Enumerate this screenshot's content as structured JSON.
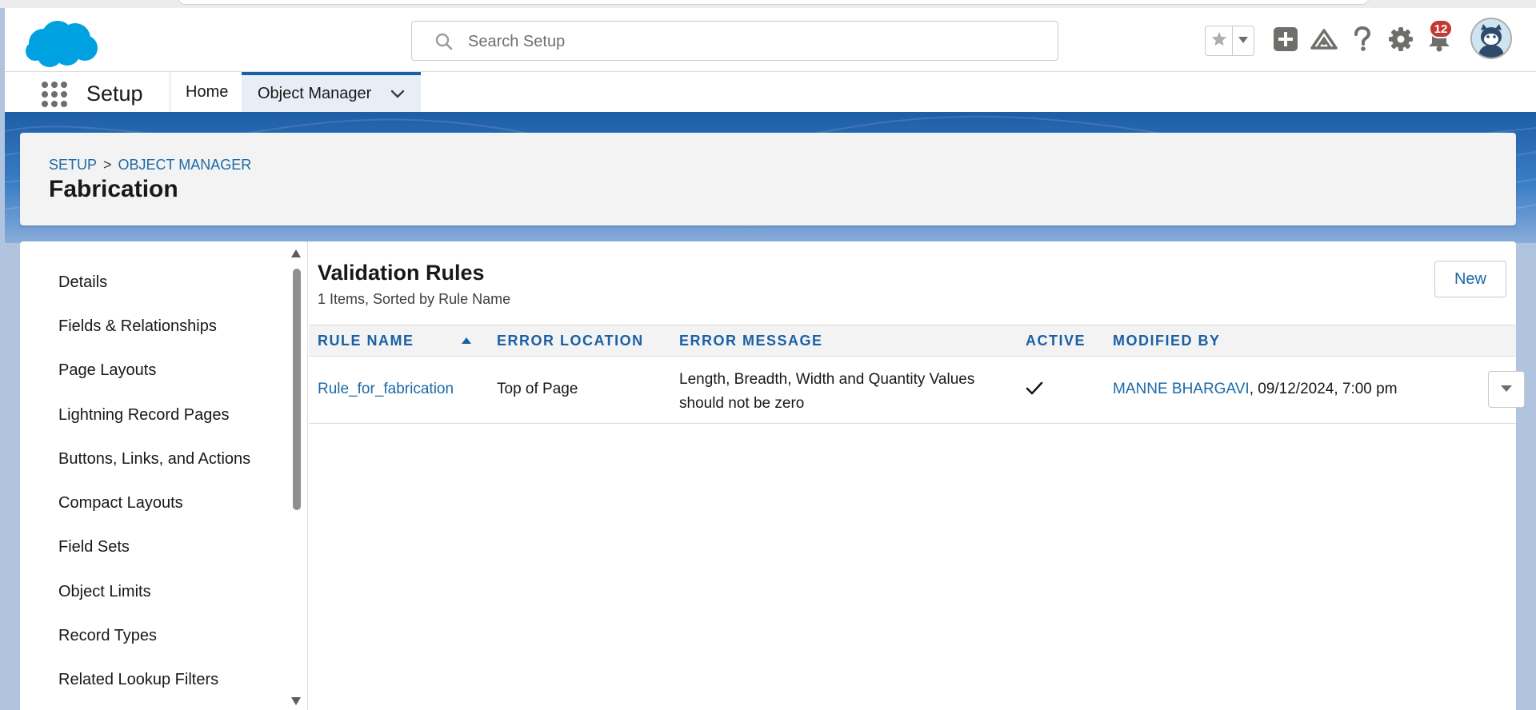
{
  "header": {
    "search": {
      "placeholder": "Search Setup",
      "value": ""
    },
    "notifications_count": "12"
  },
  "app_nav": {
    "app_name": "Setup",
    "tabs": [
      {
        "label": "Home"
      },
      {
        "label": "Object Manager"
      }
    ]
  },
  "page_header": {
    "breadcrumb": [
      "SETUP",
      ">",
      "OBJECT MANAGER"
    ],
    "title": "Fabrication"
  },
  "left_nav": {
    "items": [
      {
        "label": "Details"
      },
      {
        "label": "Fields & Relationships"
      },
      {
        "label": "Page Layouts"
      },
      {
        "label": "Lightning Record Pages"
      },
      {
        "label": "Buttons, Links, and Actions"
      },
      {
        "label": "Compact Layouts"
      },
      {
        "label": "Field Sets"
      },
      {
        "label": "Object Limits"
      },
      {
        "label": "Record Types"
      },
      {
        "label": "Related Lookup Filters"
      }
    ]
  },
  "content": {
    "title": "Validation Rules",
    "subtitle": "1 Items, Sorted by Rule Name",
    "new_button": "New",
    "columns": [
      "Rule Name",
      "Error Location",
      "Error Message",
      "Active",
      "Modified By"
    ],
    "rows": [
      {
        "rule_name": "Rule_for_fabrication",
        "error_location": "Top of Page",
        "error_message_line1": "Length, Breadth, Width and Quantity Values",
        "error_message_line2": "should not be zero",
        "active": true,
        "modified_by_user": "MANNE BHARGAVI",
        "modified_by_rest": ", 09/12/2024, 7:00 pm"
      }
    ]
  },
  "colors": {
    "brand_blue": "#1b5fa4",
    "link_blue": "#1b6aa8",
    "badge_red": "#c23934",
    "salesforce_cloud": "#00a1e0"
  },
  "icons": [
    "salesforce-logo",
    "search-icon",
    "star-icon",
    "chevron-down-icon",
    "plus-icon",
    "trailhead-icon",
    "help-icon",
    "gear-icon",
    "bell-icon",
    "avatar",
    "waffle-icon",
    "sort-ascending-icon",
    "checkmark-icon",
    "caret-down-icon"
  ]
}
